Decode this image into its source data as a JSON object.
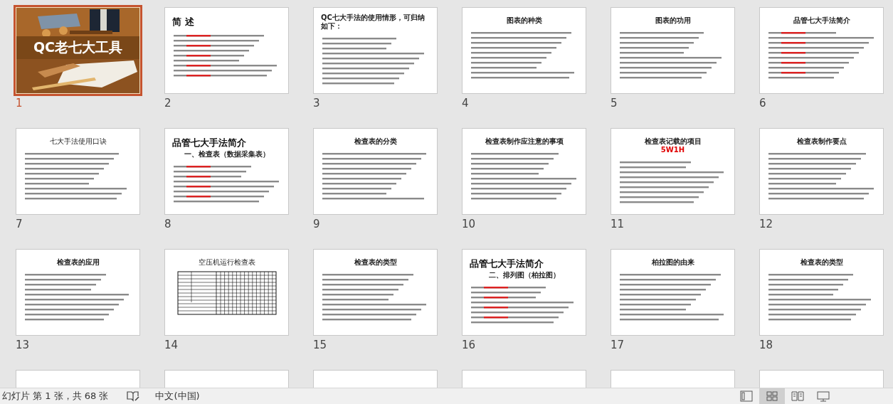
{
  "slides": [
    {
      "number": "1",
      "selected": true,
      "kind": "cover",
      "title": "QC老七大工具"
    },
    {
      "number": "2",
      "selected": false,
      "kind": "heading",
      "title": "简 述"
    },
    {
      "number": "3",
      "selected": false,
      "kind": "left",
      "title": "QC七大手法的使用情形，可归纳如下："
    },
    {
      "number": "4",
      "selected": false,
      "kind": "centered",
      "title": "图表的种类"
    },
    {
      "number": "5",
      "selected": false,
      "kind": "centered",
      "title": "图表的功用"
    },
    {
      "number": "6",
      "selected": false,
      "kind": "centered",
      "title": "品管七大手法简介"
    },
    {
      "number": "7",
      "selected": false,
      "kind": "centered",
      "title": "七大手法使用口诀"
    },
    {
      "number": "8",
      "selected": false,
      "kind": "heading",
      "title": "品管七大手法简介",
      "subtitle": "一、检查表（数据采集表）"
    },
    {
      "number": "9",
      "selected": false,
      "kind": "centered",
      "title": "检查表的分类"
    },
    {
      "number": "10",
      "selected": false,
      "kind": "centered",
      "title": "检查表制作应注意的事项"
    },
    {
      "number": "11",
      "selected": false,
      "kind": "centered",
      "title": "检查表记载的项目",
      "subtitle": "5W1H"
    },
    {
      "number": "12",
      "selected": false,
      "kind": "centered",
      "title": "检查表制作要点"
    },
    {
      "number": "13",
      "selected": false,
      "kind": "centered",
      "title": "检查表的应用"
    },
    {
      "number": "14",
      "selected": false,
      "kind": "table",
      "title": "空压机运行检查表"
    },
    {
      "number": "15",
      "selected": false,
      "kind": "centered",
      "title": "检查表的类型"
    },
    {
      "number": "16",
      "selected": false,
      "kind": "heading",
      "title": "品管七大手法简介",
      "subtitle": "二、排列图（柏拉图）"
    },
    {
      "number": "17",
      "selected": false,
      "kind": "centered",
      "title": "柏拉图的由来"
    },
    {
      "number": "18",
      "selected": false,
      "kind": "centered",
      "title": "检查表的类型"
    },
    {
      "selected": false,
      "kind": "partial"
    },
    {
      "selected": false,
      "kind": "partial"
    },
    {
      "selected": false,
      "kind": "partial"
    },
    {
      "selected": false,
      "kind": "partial"
    },
    {
      "selected": false,
      "kind": "partial"
    },
    {
      "selected": false,
      "kind": "partial"
    }
  ],
  "status_bar": {
    "slide_info": "幻灯片 第 1 张，共 68 张",
    "language": "中文(中国)",
    "views": [
      {
        "kind": "normal",
        "selected": false
      },
      {
        "kind": "sorter",
        "selected": true
      },
      {
        "kind": "reading",
        "selected": false
      },
      {
        "kind": "slideshow",
        "selected": false
      }
    ]
  }
}
